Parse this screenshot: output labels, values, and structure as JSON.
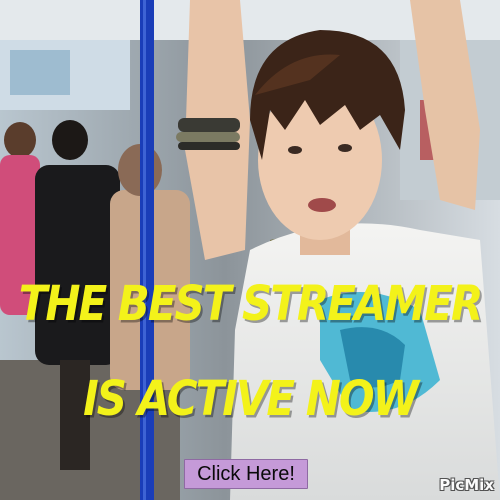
{
  "banner": {
    "headline_line1": "THE BEST STREAMER",
    "headline_line2": "IS ACTIVE NOW",
    "cta_label": "Click Here!",
    "watermark": "PicMix"
  },
  "colors": {
    "headline": "#f3f21a",
    "cta_background": "#c59ad8",
    "pole": "#1a3db8"
  }
}
